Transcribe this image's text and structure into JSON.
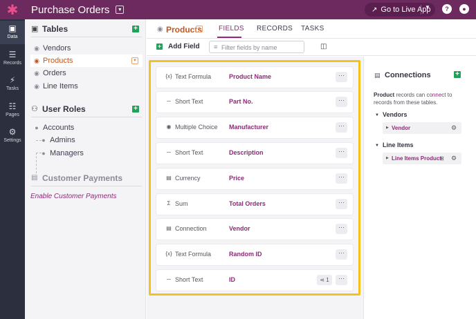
{
  "app": {
    "title": "Purchase Orders",
    "go_live_label": "Go to Live App"
  },
  "rail": [
    {
      "label": "Data",
      "icon": "data-icon"
    },
    {
      "label": "Records",
      "icon": "records-icon"
    },
    {
      "label": "Tasks",
      "icon": "tasks-icon"
    },
    {
      "label": "Pages",
      "icon": "pages-icon"
    },
    {
      "label": "Settings",
      "icon": "settings-icon"
    }
  ],
  "sidebar": {
    "tables_title": "Tables",
    "tables": [
      "Vendors",
      "Products",
      "Orders",
      "Line Items"
    ],
    "active_table": "Products",
    "roles_title": "User Roles",
    "roles": [
      "Accounts",
      "Admins",
      "Managers"
    ],
    "payments_title": "Customer Payments",
    "payments_link": "Enable Customer Payments"
  },
  "main": {
    "table_title": "Products",
    "tabs": [
      "FIELDS",
      "RECORDS",
      "TASKS"
    ],
    "active_tab": "FIELDS",
    "add_field_label": "Add Field",
    "filter_placeholder": "Filter fields by name"
  },
  "fields": [
    {
      "type": "Text Formula",
      "name": "Product Name",
      "icon": "formula-icon"
    },
    {
      "type": "Short Text",
      "name": "Part No.",
      "icon": "short-text-icon"
    },
    {
      "type": "Multiple Choice",
      "name": "Manufacturer",
      "icon": "multiple-choice-icon"
    },
    {
      "type": "Short Text",
      "name": "Description",
      "icon": "short-text-icon"
    },
    {
      "type": "Currency",
      "name": "Price",
      "icon": "currency-icon"
    },
    {
      "type": "Sum",
      "name": "Total Orders",
      "icon": "sum-icon"
    },
    {
      "type": "Connection",
      "name": "Vendor",
      "icon": "connection-icon"
    },
    {
      "type": "Text Formula",
      "name": "Random ID",
      "icon": "formula-icon"
    },
    {
      "type": "Short Text",
      "name": "ID",
      "icon": "short-text-icon",
      "links": "1"
    }
  ],
  "connections": {
    "title": "Connections",
    "desc_table": "Product",
    "desc_pre": " records can ",
    "desc_link": "connect",
    "desc_post": " to records from these tables.",
    "groups": [
      {
        "name": "Vendors",
        "items": [
          "Vendor"
        ]
      },
      {
        "name": "Line Items",
        "items": [
          "Line Items Product"
        ]
      }
    ]
  },
  "colors": {
    "topbar": "#6c2a5f",
    "accent": "#8e2a77",
    "active_table": "#c2561e",
    "plus": "#20a25a",
    "highlight": "#f4c21e"
  }
}
